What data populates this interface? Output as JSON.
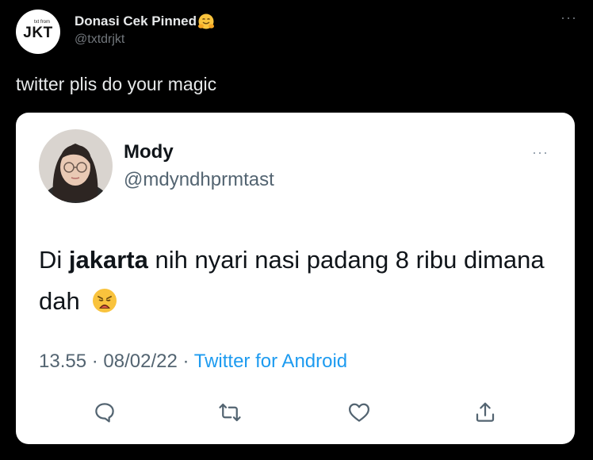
{
  "outer_tweet": {
    "display_name": "Donasi Cek Pinned",
    "handle": "@txtdrjkt",
    "avatar_logo_small": "txt from",
    "avatar_logo_main": "JKT",
    "more_icon": "more-horizontal-icon",
    "text": "twitter plis do your magic"
  },
  "quoted_tweet": {
    "display_name": "Mody",
    "handle": "@mdyndhprmtast",
    "more_icon": "more-horizontal-icon",
    "text_prefix": "Di ",
    "text_bold": "jakarta",
    "text_suffix": " nih nyari nasi padang 8 ribu dimana dah",
    "time": "13.55",
    "date": "08/02/22",
    "separator": "·",
    "source": "Twitter for Android",
    "actions": [
      "reply-icon",
      "retweet-icon",
      "like-icon",
      "share-icon"
    ]
  },
  "colors": {
    "background": "#000000",
    "card_background": "#ffffff",
    "link_blue": "#1d9bf0",
    "muted_text": "#536471"
  }
}
